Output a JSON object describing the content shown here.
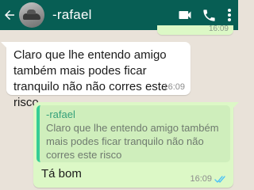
{
  "header": {
    "contact_name": "-rafael",
    "icons": [
      "back-arrow-icon",
      "avatar",
      "video-call-icon",
      "phone-icon",
      "more-options-icon"
    ],
    "color": "#075e54"
  },
  "previous_message": {
    "time": "16:09"
  },
  "incoming_message": {
    "text": "Claro que lhe entendo amigo também mais podes ficar tranquilo não não corres este risco",
    "time": "16:09"
  },
  "outgoing_message": {
    "quoted_author": "-rafael",
    "quoted_text": "Claro que lhe entendo amigo também mais podes ficar tranquilo não não corres este risco",
    "text": "Tá bom",
    "time": "16:09",
    "status": "read"
  },
  "colors": {
    "incoming_bubble": "#ffffff",
    "outgoing_bubble": "#dcf8c6",
    "read_ticks": "#4fc3f7",
    "quote_accent": "#35cd96",
    "chat_background": "#e9e2d9"
  }
}
